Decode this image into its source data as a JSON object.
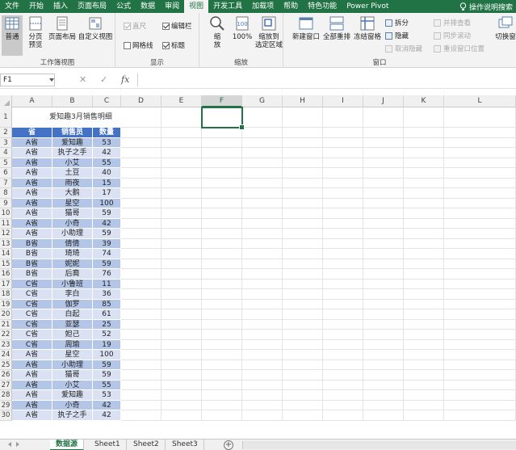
{
  "ribbon_tabs": [
    "文件",
    "开始",
    "插入",
    "页面布局",
    "公式",
    "数据",
    "审阅",
    "视图",
    "开发工具",
    "加载项",
    "帮助",
    "特色功能",
    "Power Pivot"
  ],
  "active_tab_index": 7,
  "help_search": "操作说明搜索",
  "groups": {
    "workbook_views": {
      "label": "工作簿视图",
      "normal": "普通",
      "page_break": "分页\n预览",
      "page_layout": "页面布局",
      "custom_views": "自定义视图"
    },
    "show": {
      "label": "显示",
      "ruler": "直尺",
      "formula_bar": "编辑栏",
      "gridlines": "网格线",
      "headings": "标题"
    },
    "zoom": {
      "label": "缩放",
      "zoom": "缩\n放",
      "zoom100": "100%",
      "zoom_selection": "缩放到\n选定区域"
    },
    "window": {
      "label": "窗口",
      "new_window": "新建窗口",
      "arrange_all": "全部重排",
      "freeze_panes": "冻结窗格",
      "split": "拆分",
      "hide": "隐藏",
      "unhide": "取消隐藏",
      "side_by_side": "并排查看",
      "sync_scroll": "同步滚动",
      "reset_position": "重设窗口位置",
      "switch_windows": "切换窗"
    }
  },
  "name_box": "F1",
  "formula_icons": {
    "cancel": "✕",
    "enter": "✓",
    "fx": "fx"
  },
  "columns": [
    "A",
    "B",
    "C",
    "D",
    "E",
    "F",
    "G",
    "H",
    "I",
    "J",
    "K",
    "L"
  ],
  "active_column": "F",
  "sheet_title": "爱知趣3月销售明细",
  "table_headers": [
    "省",
    "销售员",
    "数量"
  ],
  "table_rows": [
    [
      "A省",
      "爱知趣",
      "53"
    ],
    [
      "A省",
      "执子之手",
      "42"
    ],
    [
      "A省",
      "小艾",
      "55"
    ],
    [
      "A省",
      "土豆",
      "40"
    ],
    [
      "A省",
      "雨夜",
      "15"
    ],
    [
      "A省",
      "大鹅",
      "17"
    ],
    [
      "A省",
      "星空",
      "100"
    ],
    [
      "A省",
      "猫哥",
      "59"
    ],
    [
      "A省",
      "小奇",
      "42"
    ],
    [
      "A省",
      "小助理",
      "59"
    ],
    [
      "B省",
      "倩倩",
      "39"
    ],
    [
      "B省",
      "琦琦",
      "74"
    ],
    [
      "B省",
      "妮妮",
      "59"
    ],
    [
      "B省",
      "后裔",
      "76"
    ],
    [
      "C省",
      "小鲁班",
      "11"
    ],
    [
      "C省",
      "李白",
      "36"
    ],
    [
      "C省",
      "伽罗",
      "85"
    ],
    [
      "C省",
      "白起",
      "61"
    ],
    [
      "C省",
      "亚瑟",
      "25"
    ],
    [
      "C省",
      "妲己",
      "52"
    ],
    [
      "C省",
      "周瑜",
      "19"
    ],
    [
      "A省",
      "星空",
      "100"
    ],
    [
      "A省",
      "小助理",
      "59"
    ],
    [
      "A省",
      "猫哥",
      "59"
    ],
    [
      "A省",
      "小艾",
      "55"
    ],
    [
      "A省",
      "爱知趣",
      "53"
    ],
    [
      "A省",
      "小奇",
      "42"
    ],
    [
      "A省",
      "执子之手",
      "42"
    ]
  ],
  "row_numbers": [
    "1",
    "2",
    "3",
    "4",
    "5",
    "6",
    "7",
    "8",
    "9",
    "10",
    "11",
    "12",
    "13",
    "14",
    "15",
    "16",
    "17",
    "18",
    "19",
    "20",
    "21",
    "22",
    "23",
    "24",
    "25",
    "26",
    "27",
    "28",
    "29",
    "30"
  ],
  "sheet_tabs": [
    "数据源",
    "Sheet1",
    "Sheet2",
    "Sheet3"
  ],
  "active_sheet_index": 0,
  "add_sheet": "+",
  "colors": {
    "excel_green": "#217346",
    "table_header": "#4472c4",
    "table_band": "#b4c6e7",
    "table_band_alt": "#d9e1f2"
  }
}
